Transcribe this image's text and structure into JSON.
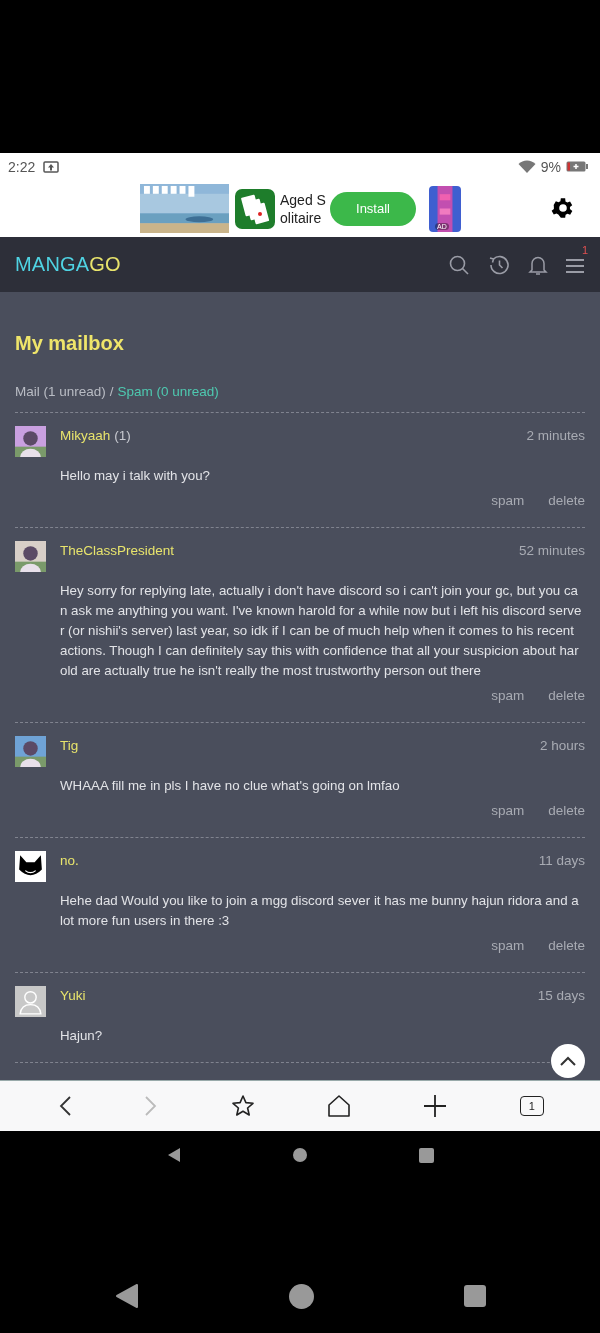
{
  "status_bar": {
    "time": "2:22",
    "battery": "9%"
  },
  "ad": {
    "app_name_lines": [
      "Aged S",
      "olitaire"
    ],
    "install": "Install",
    "badge": "AD"
  },
  "header": {
    "logo": [
      {
        "text": "MANGA",
        "color": "#4fd3e3"
      },
      {
        "text": "GO",
        "color": "#e8e46c"
      }
    ],
    "menu_badge": "1"
  },
  "page": {
    "title": "My mailbox",
    "folders": [
      {
        "label": "Mail (1 unread)",
        "selected": true
      },
      {
        "label": "Spam (0 unread)",
        "selected": false
      }
    ],
    "separator": "/",
    "messages": [
      {
        "name": "Mikyaah",
        "unread_count": "(1)",
        "time": "2 minutes",
        "body": "Hello may i talk with you?",
        "actions": [
          "spam",
          "delete"
        ]
      },
      {
        "name": "TheClassPresident",
        "time": "52 minutes",
        "body": "Hey sorry for replying late, actually i don't have discord so i can't join your gc, but you can ask me anything you want. I've known harold for a while now but i left his discord server (or nishii's server) last year, so idk if I can be of much help when it comes to his recent actions. Though I can definitely say this with confidence that all your suspicion about harold are actually true he isn't really the most trustworthy person out there",
        "actions": [
          "spam",
          "delete"
        ]
      },
      {
        "name": "Tig",
        "time": "2 hours",
        "body": "WHAAA fill me in pls I have no clue what's going on lmfao",
        "actions": [
          "spam",
          "delete"
        ]
      },
      {
        "kind": "cat",
        "name": "no.",
        "time": "11 days",
        "body": "Hehe dad Would you like to join a mgg discord sever it has me bunny hajun ridora and a lot more fun users in there :3",
        "actions": [
          "spam",
          "delete"
        ]
      },
      {
        "kind": "silhouette",
        "name": "Yuki",
        "time": "15 days",
        "body": "Hajun?"
      }
    ]
  },
  "browser_toolbar": {
    "forward_disabled": true,
    "tab_count": "1"
  }
}
